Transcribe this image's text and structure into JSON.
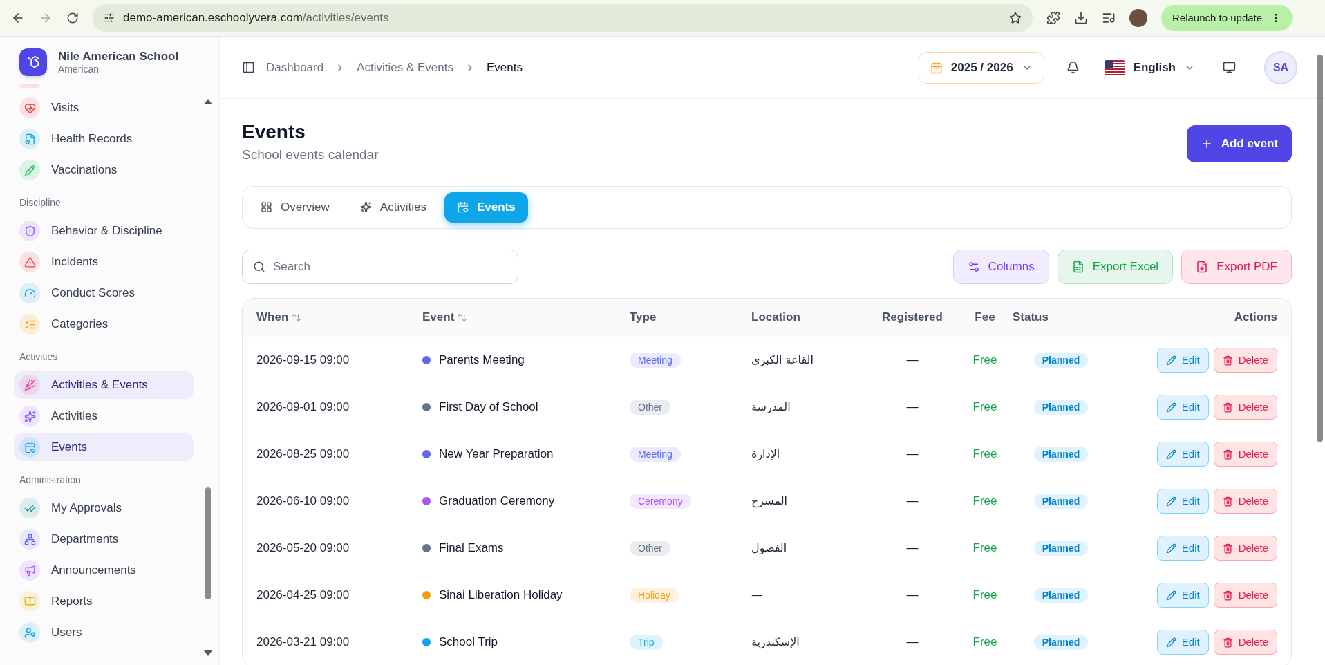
{
  "browser": {
    "url_host": "demo-american.eschoolyvera.com",
    "url_path": "/activities/events",
    "relaunch": "Relaunch to update"
  },
  "school": {
    "name": "Nile American School",
    "subtitle": "American"
  },
  "sidebar": [
    {
      "kind": "item",
      "label": "Visits",
      "color": "#ef4444",
      "selected": false
    },
    {
      "kind": "item",
      "label": "Health Records",
      "color": "#0ea5e9",
      "selected": false
    },
    {
      "kind": "item",
      "label": "Vaccinations",
      "color": "#22c55e",
      "selected": false
    },
    {
      "kind": "heading",
      "label": "Discipline"
    },
    {
      "kind": "item",
      "label": "Behavior & Discipline",
      "color": "#8b5cf6",
      "selected": false
    },
    {
      "kind": "item",
      "label": "Incidents",
      "color": "#ef4444",
      "selected": false
    },
    {
      "kind": "item",
      "label": "Conduct Scores",
      "color": "#0ea5e9",
      "selected": false
    },
    {
      "kind": "item",
      "label": "Categories",
      "color": "#f59e0b",
      "selected": false
    },
    {
      "kind": "heading",
      "label": "Activities"
    },
    {
      "kind": "item",
      "label": "Activities & Events",
      "color": "#ec4899",
      "selected": true
    },
    {
      "kind": "item",
      "label": "Activities",
      "color": "#8b5cf6",
      "selected": false
    },
    {
      "kind": "item",
      "label": "Events",
      "color": "#0ea5e9",
      "selected": true
    },
    {
      "kind": "heading",
      "label": "Administration"
    },
    {
      "kind": "item",
      "label": "My Approvals",
      "color": "#0d9488",
      "selected": false
    },
    {
      "kind": "item",
      "label": "Departments",
      "color": "#6366f1",
      "selected": false
    },
    {
      "kind": "item",
      "label": "Announcements",
      "color": "#a855f7",
      "selected": false
    },
    {
      "kind": "item",
      "label": "Reports",
      "color": "#eab308",
      "selected": false
    },
    {
      "kind": "item",
      "label": "Users",
      "color": "#0ea5e9",
      "selected": false
    }
  ],
  "breadcrumb": [
    "Dashboard",
    "Activities & Events",
    "Events"
  ],
  "topbar": {
    "year": "2025 / 2026",
    "language": "English",
    "avatar": "SA"
  },
  "page": {
    "title": "Events",
    "subtitle": "School events calendar",
    "add_button": "Add event"
  },
  "tabs": [
    {
      "label": "Overview",
      "selected": false
    },
    {
      "label": "Activities",
      "selected": false
    },
    {
      "label": "Events",
      "selected": true
    }
  ],
  "search": {
    "placeholder": "Search"
  },
  "toolbar": [
    "Columns",
    "Export Excel",
    "Export PDF"
  ],
  "table": {
    "columns": [
      {
        "label": "When",
        "sortable": true
      },
      {
        "label": "Event",
        "sortable": true
      },
      {
        "label": "Type",
        "sortable": false
      },
      {
        "label": "Location",
        "sortable": false
      },
      {
        "label": "Registered",
        "sortable": false
      },
      {
        "label": "Fee",
        "sortable": false
      },
      {
        "label": "Status",
        "sortable": false
      },
      {
        "label": "Actions",
        "sortable": false
      }
    ],
    "rows": [
      {
        "when": "2026-09-15 09:00",
        "event": "Parents Meeting",
        "color": "#6366f1",
        "type": "Meeting",
        "location": "القاعة الكبرى",
        "registered": "—",
        "fee": "Free",
        "status": "Planned",
        "edit": "Edit",
        "delete": "Delete"
      },
      {
        "when": "2026-09-01 09:00",
        "event": "First Day of School",
        "color": "#64748b",
        "type": "Other",
        "location": "المدرسة",
        "registered": "—",
        "fee": "Free",
        "status": "Planned",
        "edit": "Edit",
        "delete": "Delete"
      },
      {
        "when": "2026-08-25 09:00",
        "event": "New Year Preparation",
        "color": "#6366f1",
        "type": "Meeting",
        "location": "الإدارة",
        "registered": "—",
        "fee": "Free",
        "status": "Planned",
        "edit": "Edit",
        "delete": "Delete"
      },
      {
        "when": "2026-06-10 09:00",
        "event": "Graduation Ceremony",
        "color": "#a855f7",
        "type": "Ceremony",
        "location": "المسرح",
        "registered": "—",
        "fee": "Free",
        "status": "Planned",
        "edit": "Edit",
        "delete": "Delete"
      },
      {
        "when": "2026-05-20 09:00",
        "event": "Final Exams",
        "color": "#64748b",
        "type": "Other",
        "location": "الفصول",
        "registered": "—",
        "fee": "Free",
        "status": "Planned",
        "edit": "Edit",
        "delete": "Delete"
      },
      {
        "when": "2026-04-25 09:00",
        "event": "Sinai Liberation Holiday",
        "color": "#f59e0b",
        "type": "Holiday",
        "location": "—",
        "registered": "—",
        "fee": "Free",
        "status": "Planned",
        "edit": "Edit",
        "delete": "Delete"
      },
      {
        "when": "2026-03-21 09:00",
        "event": "School Trip",
        "color": "#0ea5e9",
        "type": "Trip",
        "location": "الإسكندرية",
        "registered": "—",
        "fee": "Free",
        "status": "Planned",
        "edit": "Edit",
        "delete": "Delete"
      }
    ]
  }
}
